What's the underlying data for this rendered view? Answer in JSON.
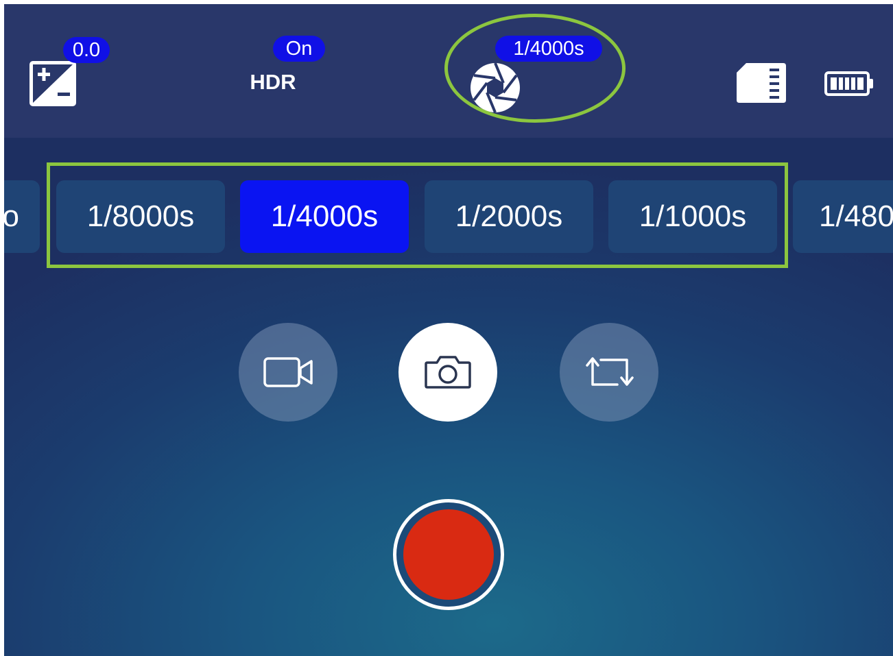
{
  "colors": {
    "accent": "#0a14f2",
    "highlight": "#8cc63f",
    "record": "#d92a12",
    "topbar": "#29376a"
  },
  "topbar": {
    "exposure": {
      "icon": "exposure-compensation-icon",
      "value": "0.0"
    },
    "hdr": {
      "label": "HDR",
      "value": "On"
    },
    "shutter": {
      "icon": "aperture-icon",
      "value": "1/4000s"
    },
    "storage": {
      "icon": "sd-card-icon"
    },
    "battery": {
      "icon": "battery-icon"
    }
  },
  "shutter_options": [
    {
      "label": "o",
      "selected": false
    },
    {
      "label": "1/8000s",
      "selected": false
    },
    {
      "label": "1/4000s",
      "selected": true
    },
    {
      "label": "1/2000s",
      "selected": false
    },
    {
      "label": "1/1000s",
      "selected": false
    },
    {
      "label": "1/480",
      "selected": false
    }
  ],
  "modes": [
    {
      "name": "video",
      "icon": "video-camera-icon",
      "active": false
    },
    {
      "name": "photo",
      "icon": "camera-icon",
      "active": true
    },
    {
      "name": "switch",
      "icon": "swap-icon",
      "active": false
    }
  ],
  "record": {
    "icon": "record-icon"
  }
}
